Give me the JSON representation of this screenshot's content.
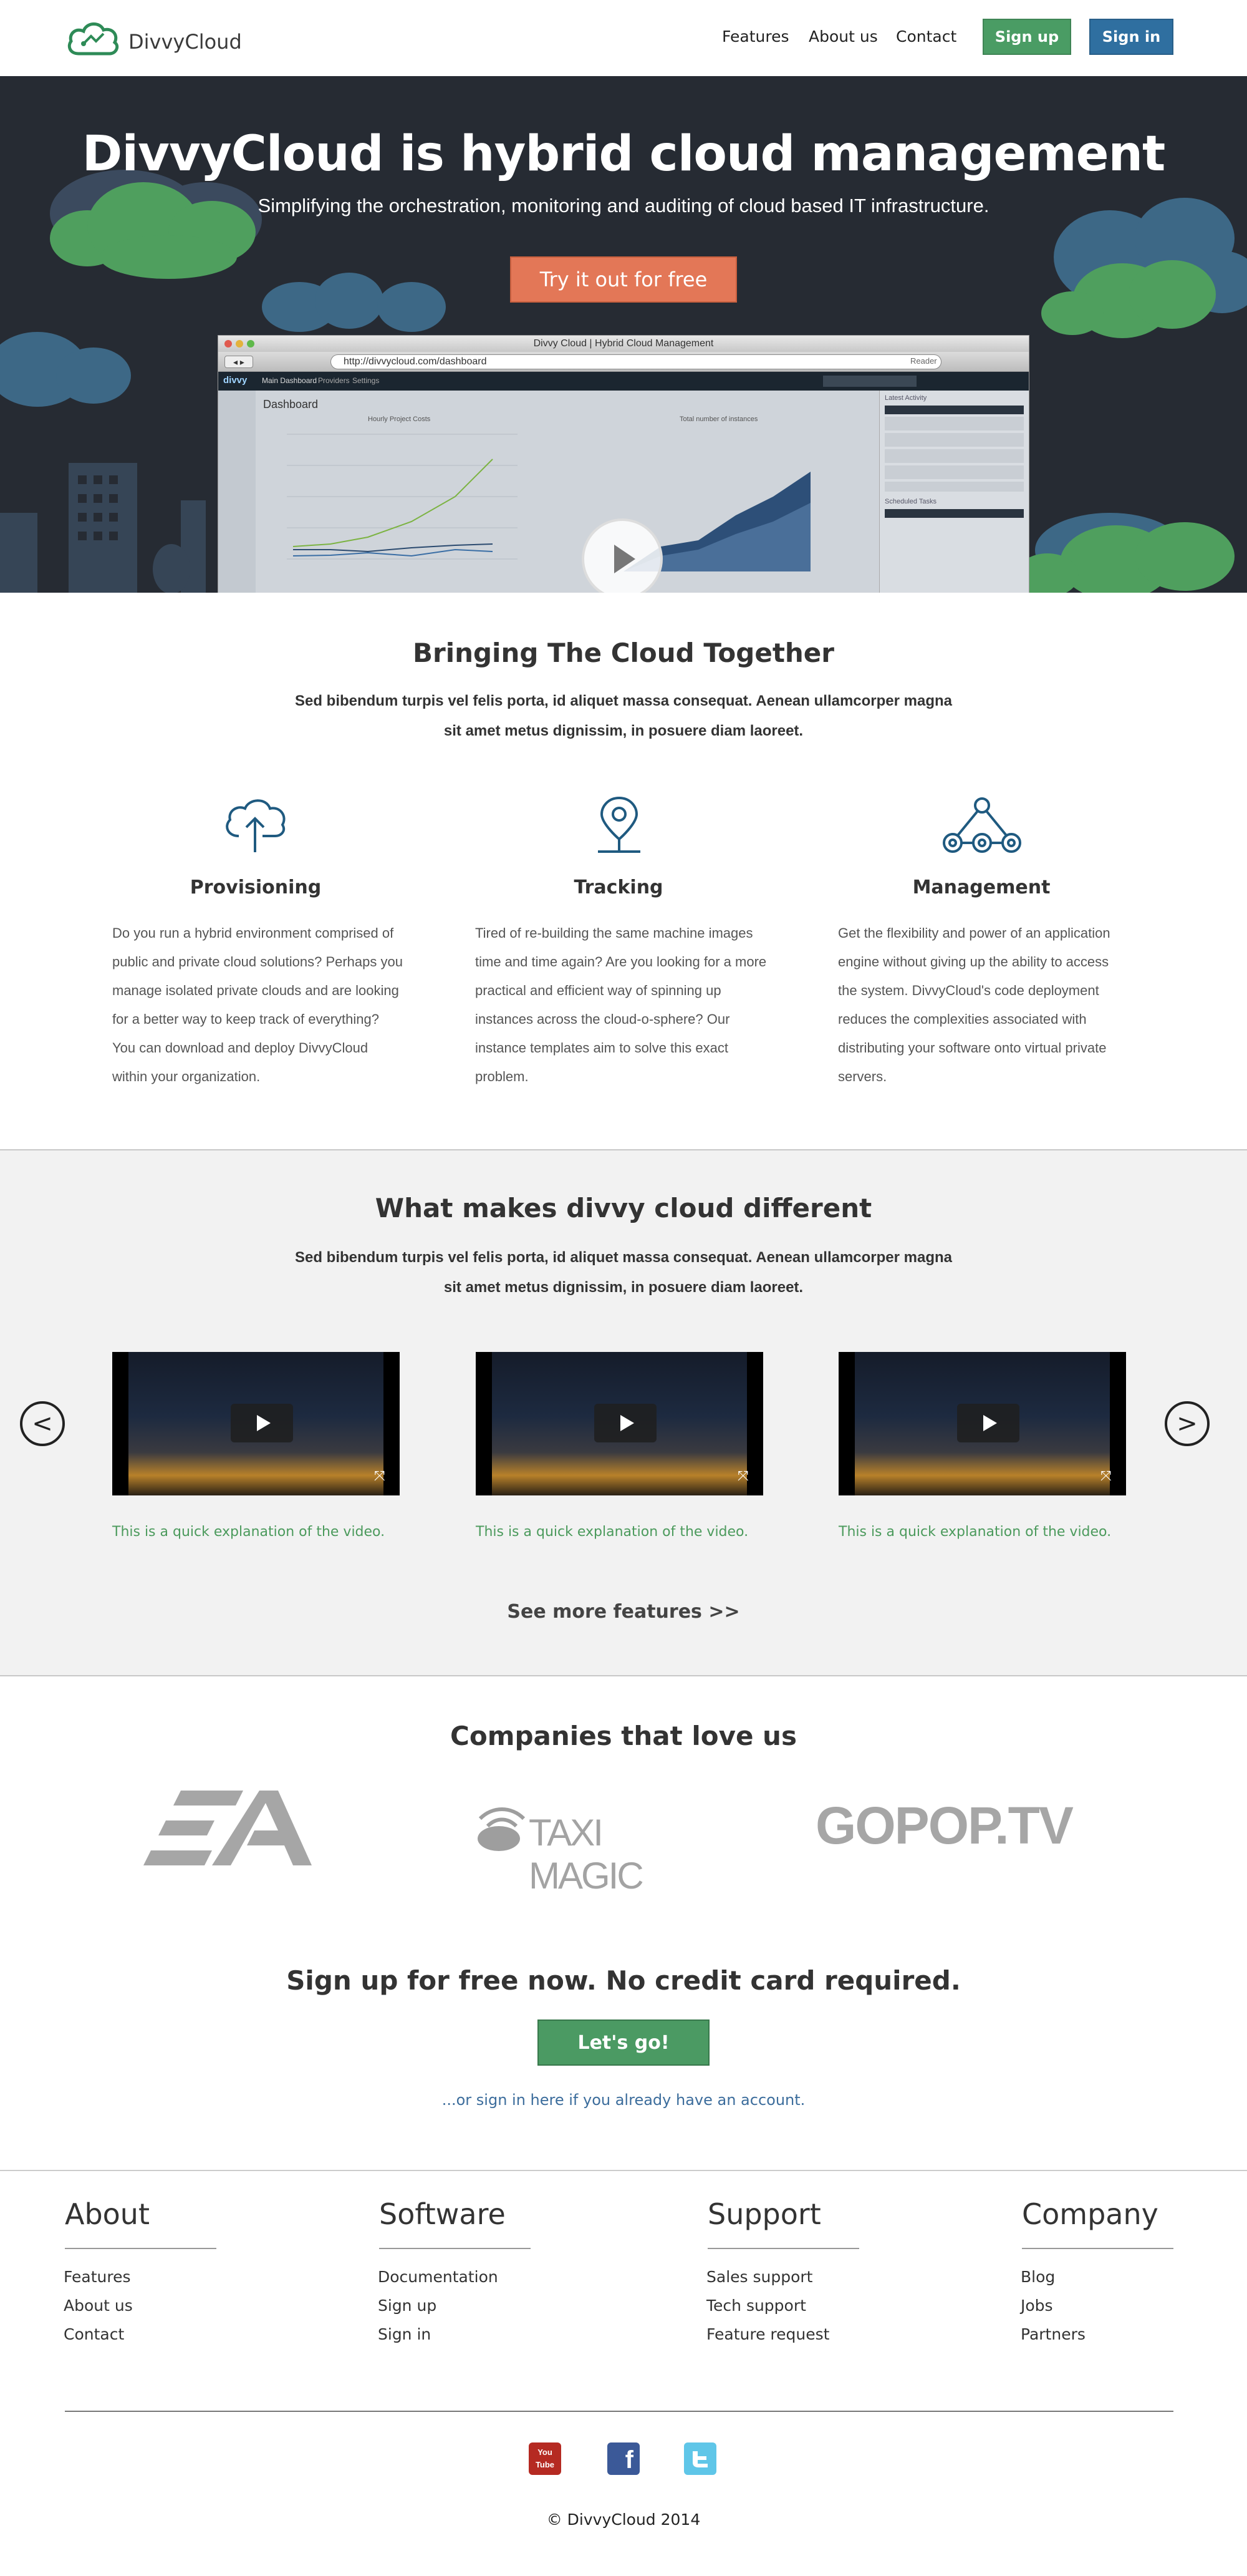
{
  "header": {
    "logo_text": "DivvyCloud",
    "nav": [
      "Features",
      "About us",
      "Contact"
    ],
    "signup_label": "Sign up",
    "signin_label": "Sign in",
    "signup_color": "#4a9c64",
    "signin_color": "#2f6fa0"
  },
  "hero": {
    "title": "DivvyCloud is hybrid cloud management",
    "subtitle": "Simplifying the orchestration, monitoring and auditing of cloud based IT infrastructure.",
    "cta_label": "Try it out for free",
    "cta_color": "#e37757",
    "browser": {
      "window_title": "Divvy Cloud | Hybrid Cloud Management",
      "url": "http://divvycloud.com/dashboard",
      "reader_label": "Reader",
      "app_name": "divvy",
      "app_tabs": [
        "Main Dashboard",
        "Providers",
        "Settings"
      ],
      "dashboard_title": "Dashboard",
      "chart1_title": "Hourly Project Costs",
      "chart2_title": "Total number of instances",
      "panel1_title": "Latest Activity",
      "panel2_title": "Scheduled Tasks"
    }
  },
  "together": {
    "title": "Bringing The Cloud Together",
    "subtitle": "Sed bibendum turpis vel felis porta, id aliquet massa consequat. Aenean ullamcorper magna sit amet metus dignissim, in posuere diam laoreet.",
    "features": [
      {
        "icon": "cloud-upload-icon",
        "title": "Provisioning",
        "text": "Do you run a hybrid environment comprised of public and private cloud solutions? Perhaps you manage isolated private clouds and are looking for a better way to keep track of everything? You can download and deploy DivvyCloud within your organization."
      },
      {
        "icon": "map-pin-icon",
        "title": "Tracking",
        "text": "Tired of re-building the same machine images time and time again? Are you looking for a more practical and efficient way of spinning up instances across the cloud-o-sphere? Our instance templates aim to solve this exact problem."
      },
      {
        "icon": "network-nodes-icon",
        "title": "Management",
        "text": "Get the flexibility and power of an application engine without giving up the ability to access the system. DivvyCloud's code deployment reduces the complexities associated with distributing your software onto virtual private servers."
      }
    ]
  },
  "different": {
    "title": "What makes divvy cloud different",
    "subtitle": "Sed bibendum turpis vel felis porta, id aliquet massa consequat. Aenean ullamcorper magna sit amet metus dignissim, in posuere diam laoreet.",
    "videos": [
      {
        "caption": "This is a quick explanation of the video."
      },
      {
        "caption": "This is a quick explanation of the video."
      },
      {
        "caption": "This is a quick explanation of the video."
      }
    ],
    "prev_arrow": "<",
    "next_arrow": ">",
    "see_more": "See more features >>"
  },
  "companies": {
    "title": "Companies that love us",
    "logos": [
      "EA",
      "TAXI MAGIC",
      "GOPOP.TV"
    ]
  },
  "cta": {
    "title": "Sign up for free now. No credit card required.",
    "button": "Let's go!",
    "button_color": "#4b9a63",
    "signin_link": "...or sign in here if you already have an account."
  },
  "footer": {
    "columns": [
      {
        "heading": "About",
        "links": [
          "Features",
          "About us",
          "Contact"
        ]
      },
      {
        "heading": "Software",
        "links": [
          "Documentation",
          "Sign up",
          "Sign in"
        ]
      },
      {
        "heading": "Support",
        "links": [
          "Sales support",
          "Tech support",
          "Feature request"
        ]
      },
      {
        "heading": "Company",
        "links": [
          "Blog",
          "Jobs",
          "Partners"
        ]
      }
    ],
    "social": [
      "youtube-icon",
      "facebook-icon",
      "twitter-icon"
    ],
    "youtube_label": "You Tube",
    "copyright": "© DivvyCloud 2014"
  }
}
